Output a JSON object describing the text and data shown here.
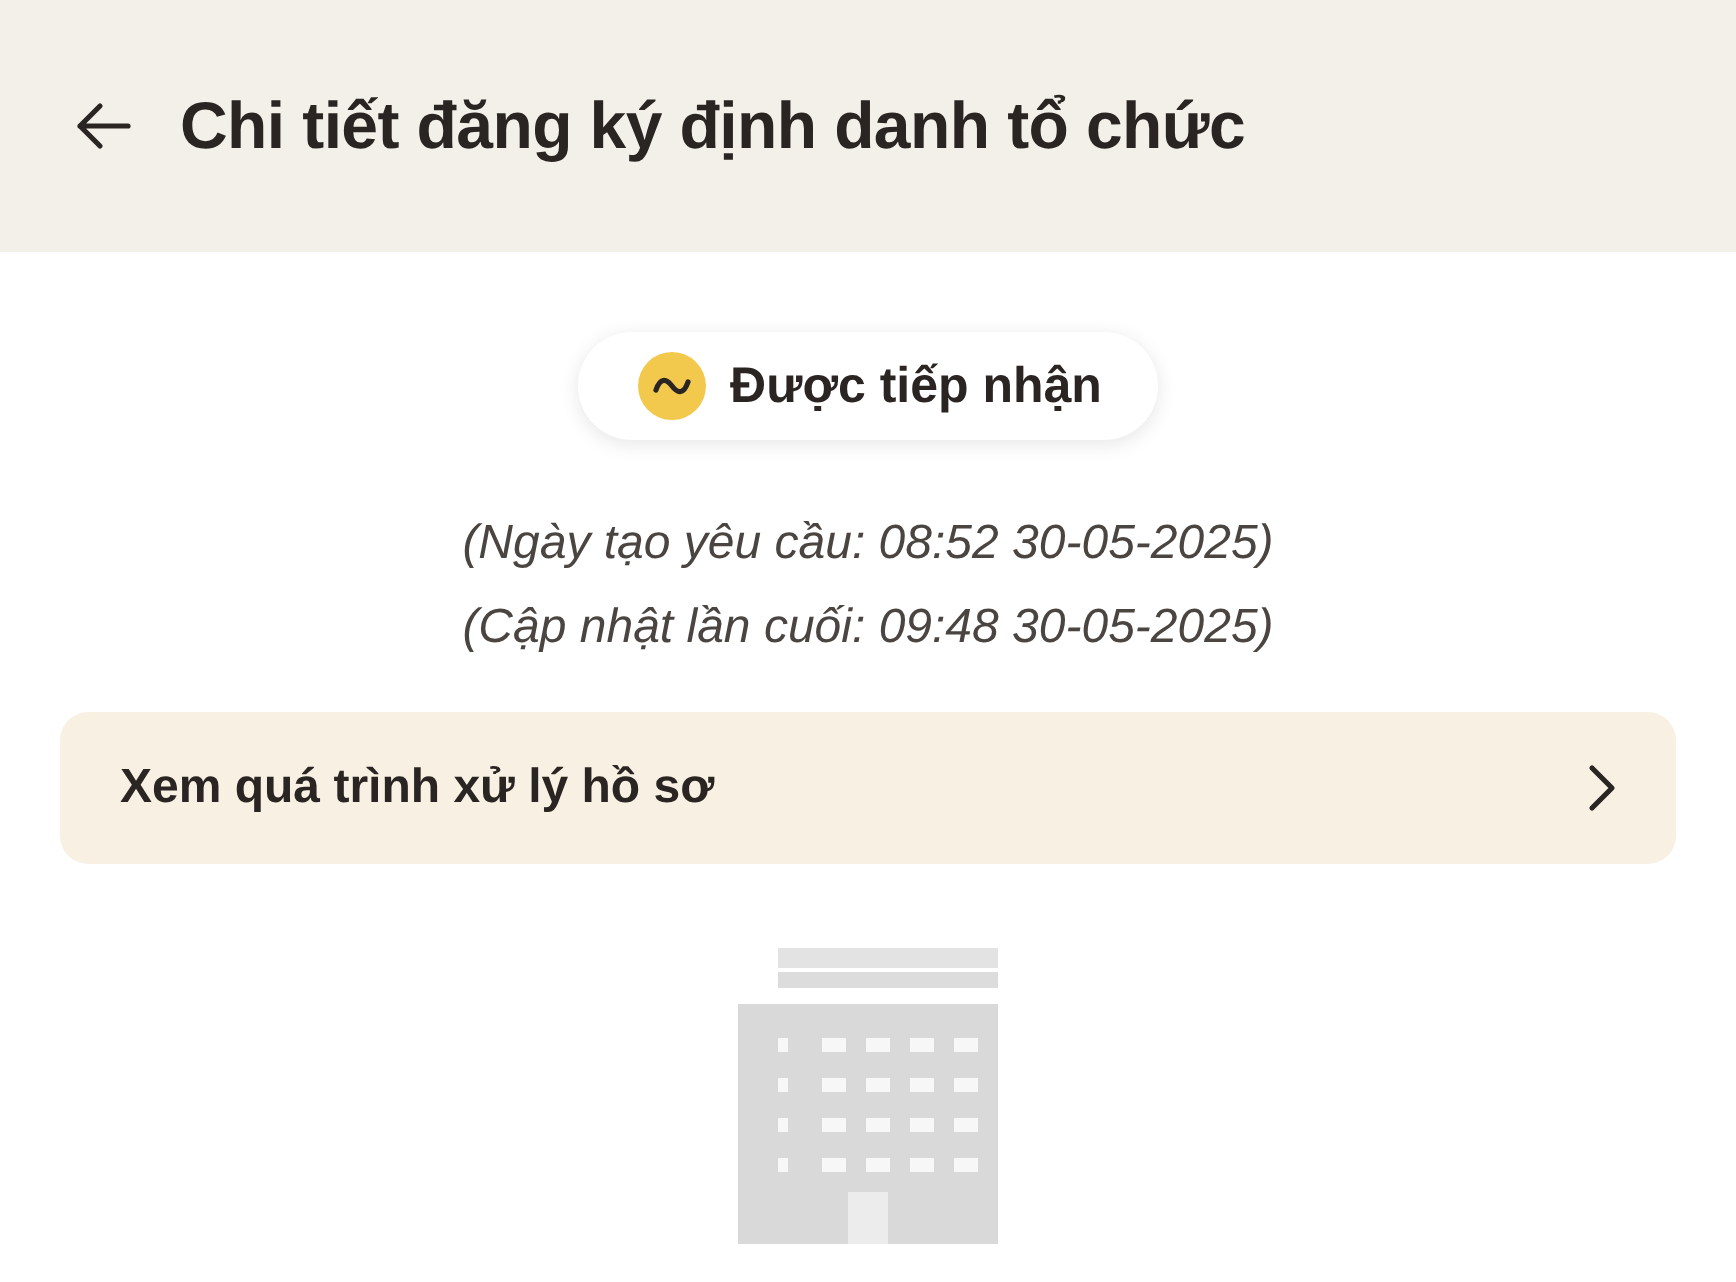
{
  "header": {
    "title": "Chi tiết đăng ký định danh tổ chức"
  },
  "status": {
    "label": "Được tiếp nhận"
  },
  "dates": [
    "(Ngày tạo yêu cầu: 08:52 30-05-2025)",
    "(Cập nhật lần cuối: 09:48 30-05-2025)"
  ],
  "process_link": {
    "label": "Xem quá trình xử lý hồ sơ"
  }
}
